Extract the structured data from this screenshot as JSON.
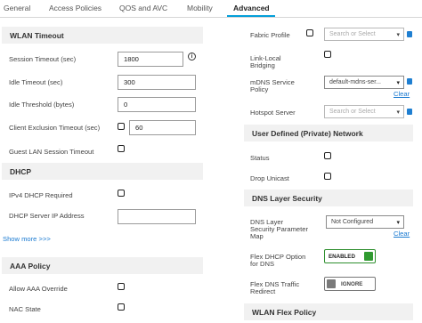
{
  "tabs": [
    {
      "label": "General"
    },
    {
      "label": "Access Policies"
    },
    {
      "label": "QOS and AVC"
    },
    {
      "label": "Mobility"
    },
    {
      "label": "Advanced",
      "active": true
    }
  ],
  "wlan_timeout": {
    "title": "WLAN Timeout",
    "session_timeout_label": "Session Timeout (sec)",
    "session_timeout_value": "1800",
    "idle_timeout_label": "Idle Timeout (sec)",
    "idle_timeout_value": "300",
    "idle_threshold_label": "Idle Threshold (bytes)",
    "idle_threshold_value": "0",
    "client_exclusion_label": "Client Exclusion Timeout (sec)",
    "client_exclusion_value": "60",
    "guest_lan_label": "Guest LAN Session Timeout"
  },
  "dhcp": {
    "title": "DHCP",
    "ipv4_required_label": "IPv4 DHCP Required",
    "server_ip_label": "DHCP Server IP Address",
    "server_ip_value": "",
    "show_more": "Show more >>>"
  },
  "aaa": {
    "title": "AAA Policy",
    "allow_override_label": "Allow AAA Override",
    "nac_state_label": "NAC State"
  },
  "right": {
    "fabric_profile_label": "Fabric Profile",
    "fabric_profile_placeholder": "Search or Select",
    "link_local_label_1": "Link-Local",
    "link_local_label_2": "Bridging",
    "mdns_label_1": "mDNS Service",
    "mdns_label_2": "Policy",
    "mdns_value": "default-mdns-ser...",
    "clear_label": "Clear",
    "hotspot_label": "Hotspot Server",
    "hotspot_placeholder": "Search or Select"
  },
  "user_defined": {
    "title": "User Defined (Private) Network",
    "status_label": "Status",
    "drop_unicast_label": "Drop Unicast"
  },
  "dns_security": {
    "title": "DNS Layer Security",
    "param_map_label_1": "DNS Layer",
    "param_map_label_2": "Security Parameter",
    "param_map_label_3": "Map",
    "param_map_value": "Not Configured",
    "clear_label": "Clear",
    "flex_dhcp_label_1": "Flex DHCP Option",
    "flex_dhcp_label_2": "for DNS",
    "flex_dhcp_toggle": "ENABLED",
    "flex_redirect_label_1": "Flex DNS Traffic",
    "flex_redirect_label_2": "Redirect",
    "flex_redirect_toggle": "IGNORE"
  },
  "wlan_flex": {
    "title": "WLAN Flex Policy"
  },
  "colors": {
    "accent": "#049fd9",
    "link": "#1a7ad1",
    "section_bg": "#f1f1f1",
    "toggle_on": "#2f9a2f"
  },
  "icons": {
    "info": "info-icon",
    "edit": "edit-icon",
    "dropdown": "chevron-down-icon"
  }
}
